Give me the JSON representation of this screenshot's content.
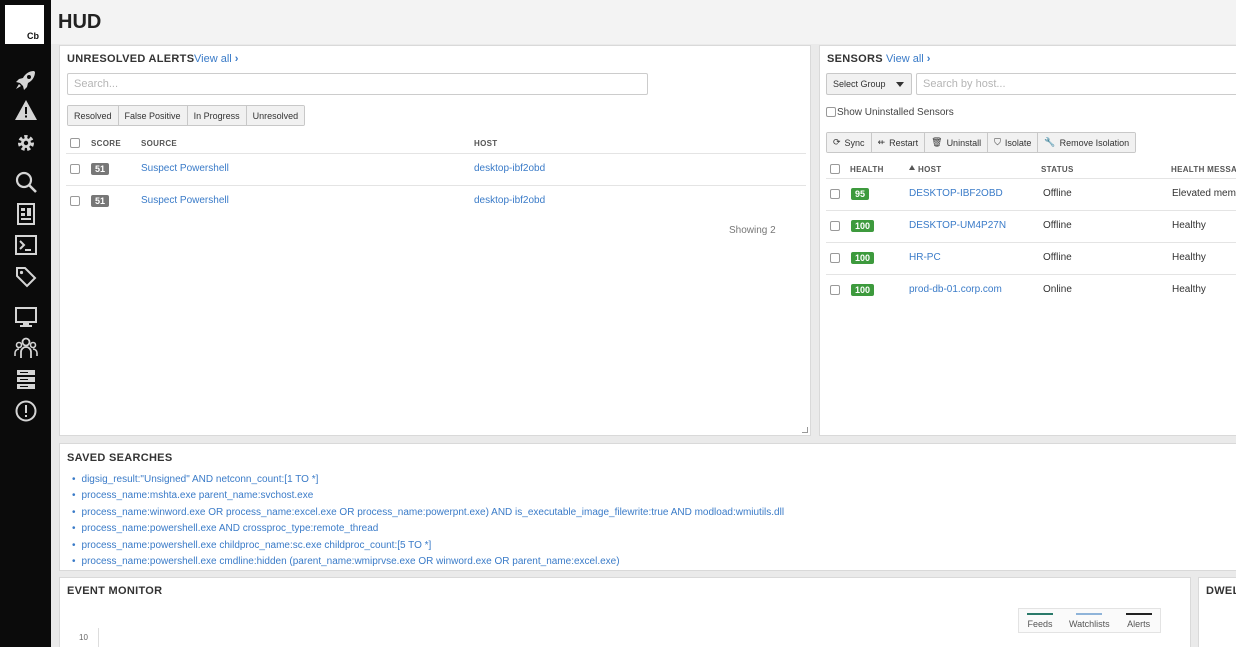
{
  "logo": {
    "text": "Cb"
  },
  "sidebar": {
    "items": [
      {
        "icon": "rocket-icon"
      },
      {
        "icon": "warning-icon"
      },
      {
        "icon": "gear-icon"
      },
      {
        "icon": "search-icon"
      },
      {
        "icon": "report-icon"
      },
      {
        "icon": "terminal-icon"
      },
      {
        "icon": "tag-icon"
      },
      {
        "icon": "monitor-icon"
      },
      {
        "icon": "users-icon"
      },
      {
        "icon": "server-icon"
      },
      {
        "icon": "alert-circle-icon"
      }
    ]
  },
  "header": {
    "title": "HUD"
  },
  "alerts": {
    "title": "UNRESOLVED ALERTS",
    "view_all": "View all",
    "search_placeholder": "Search...",
    "filters": [
      "Resolved",
      "False Positive",
      "In Progress",
      "Unresolved"
    ],
    "columns": {
      "score": "SCORE",
      "source": "SOURCE",
      "host": "HOST"
    },
    "rows": [
      {
        "score": "51",
        "source": "Suspect Powershell",
        "host": "desktop-ibf2obd"
      },
      {
        "score": "51",
        "source": "Suspect Powershell",
        "host": "desktop-ibf2obd"
      }
    ],
    "showing": "Showing 2"
  },
  "sensors": {
    "title": "SENSORS",
    "view_all": "View all",
    "group_select": "Select Group",
    "search_placeholder": "Search by host...",
    "show_uninstalled": "Show Uninstalled Sensors",
    "actions": [
      "Sync",
      "Restart",
      "Uninstall",
      "Isolate",
      "Remove Isolation"
    ],
    "columns": {
      "health": "HEALTH",
      "host": "HOST",
      "status": "STATUS",
      "message": "HEALTH MESSA"
    },
    "rows": [
      {
        "health": "95",
        "host": "DESKTOP-IBF2OBD",
        "status": "Offline",
        "message": "Elevated mem"
      },
      {
        "health": "100",
        "host": "DESKTOP-UM4P27N",
        "status": "Offline",
        "message": "Healthy"
      },
      {
        "health": "100",
        "host": "HR-PC",
        "status": "Offline",
        "message": "Healthy"
      },
      {
        "health": "100",
        "host": "prod-db-01.corp.com",
        "status": "Online",
        "message": "Healthy"
      }
    ],
    "colors": {
      "health_95": "#3d9a3d",
      "health_100": "#3d8a3d"
    }
  },
  "saved_searches": {
    "title": "SAVED SEARCHES",
    "items": [
      "digsig_result:\"Unsigned\" AND netconn_count:[1 TO *]",
      "process_name:mshta.exe parent_name:svchost.exe",
      "process_name:winword.exe OR process_name:excel.exe OR process_name:powerpnt.exe) AND is_executable_image_filewrite:true AND modload:wmiutils.dll",
      "process_name:powershell.exe AND crossproc_type:remote_thread",
      "process_name:powershell.exe childproc_name:sc.exe childproc_count:[5 TO *]",
      "process_name:powershell.exe cmdline:hidden (parent_name:wmiprvse.exe OR winword.exe OR parent_name:excel.exe)"
    ]
  },
  "event_monitor": {
    "title": "EVENT MONITOR",
    "y_tick": "10",
    "legend": [
      {
        "label": "Feeds",
        "color": "#2a7a6a"
      },
      {
        "label": "Watchlists",
        "color": "#8fb4d9"
      },
      {
        "label": "Alerts",
        "color": "#222222"
      }
    ]
  },
  "dwell": {
    "title": "DWEL"
  }
}
